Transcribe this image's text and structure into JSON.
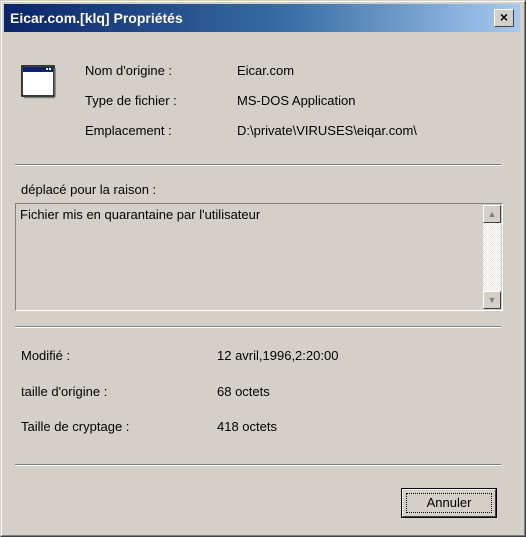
{
  "window": {
    "title": "Eicar.com.[klq] Propriétés",
    "close_label": "×"
  },
  "file_info": {
    "original_name_label": "Nom d'origine :",
    "original_name_value": "Eicar.com",
    "file_type_label": "Type de fichier :",
    "file_type_value": "MS-DOS Application",
    "location_label": "Emplacement :",
    "location_value": "D:\\private\\VIRUSES\\eiqar.com\\"
  },
  "reason": {
    "label": "déplacé pour la raison :",
    "text": "Fichier mis en quarantaine par l'utilisateur",
    "scroll_up_glyph": "▲",
    "scroll_down_glyph": "▼"
  },
  "details": {
    "modified_label": "Modifié :",
    "modified_value": "12  avril,1996,2:20:00",
    "original_size_label": "taille d'origine :",
    "original_size_value": "68 octets",
    "encrypted_size_label": "Taille de cryptage :",
    "encrypted_size_value": "418 octets"
  },
  "buttons": {
    "cancel_label": "Annuler"
  },
  "icons": {
    "file": "application-window-icon",
    "close": "close-icon"
  },
  "colors": {
    "title_bar_start": "#0A246A",
    "title_bar_end": "#A6CAF0",
    "dialog_bg": "#D4D0C8"
  }
}
